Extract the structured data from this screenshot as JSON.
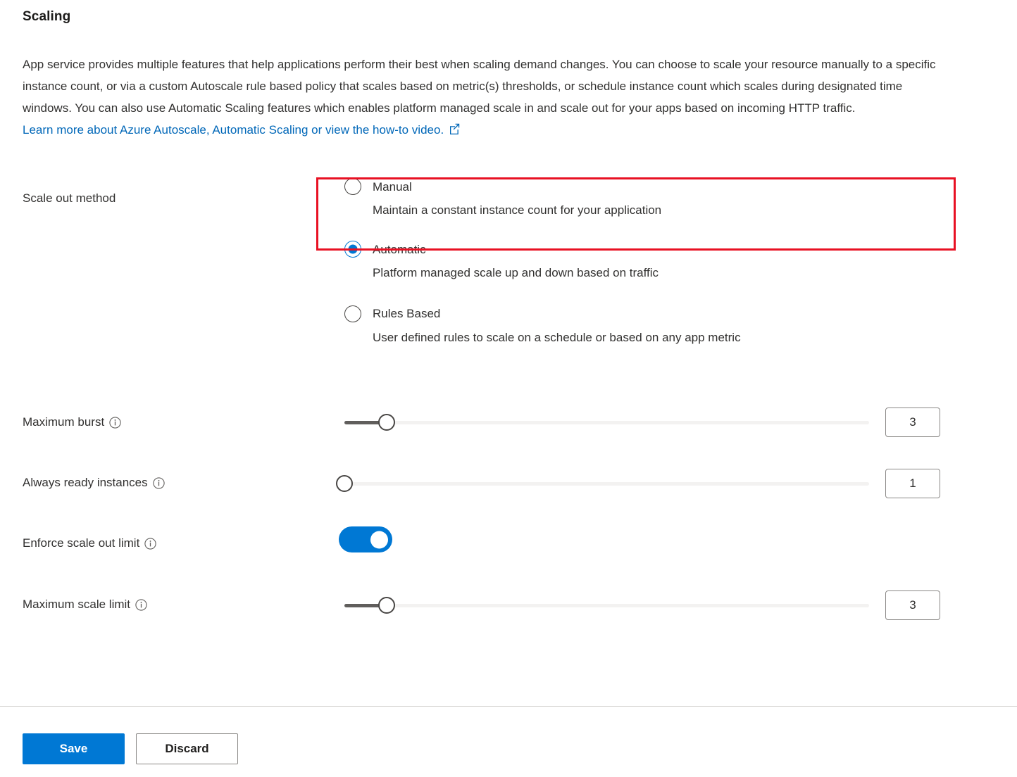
{
  "page": {
    "title": "Scaling",
    "description_lines": [
      "App service provides multiple features that help applications perform their best when scaling demand changes. You can choose",
      "to scale your resource manually to a specific instance count, or via a custom Autoscale rule based policy that scales based on",
      "metric(s) thresholds, or schedule instance count which scales during designated time windows. You can also use Automatic",
      "Scaling features which enables platform managed scale in and scale out for your apps based on incoming HTTP traffic."
    ],
    "learn_more_text": "Learn more about Azure Autoscale, Automatic Scaling or view the how-to video.",
    "external_link_icon": "external-link-icon"
  },
  "scale_out_method": {
    "label": "Scale out method",
    "selected": "Automatic",
    "options": [
      {
        "label": "Manual",
        "description": "Maintain a constant instance count for your application",
        "checked": false,
        "highlighted": true
      },
      {
        "label": "Automatic",
        "description": "Platform managed scale up and down based on traffic",
        "checked": true,
        "highlighted": false
      },
      {
        "label": "Rules Based",
        "description": "User defined rules to scale on a schedule or based on any app metric",
        "checked": false,
        "highlighted": false
      }
    ]
  },
  "settings": {
    "maximum_burst": {
      "label": "Maximum burst",
      "info_icon": "info-icon",
      "value": "3",
      "slider_percent": 8
    },
    "always_ready_instances": {
      "label": "Always ready instances",
      "info_icon": "info-icon",
      "value": "1",
      "slider_percent": 0
    },
    "enforce_scale_out_limit": {
      "label": "Enforce scale out limit",
      "info_icon": "info-icon",
      "toggle_on": true,
      "toggle_state": "On"
    },
    "maximum_scale_limit": {
      "label": "Maximum scale limit",
      "info_icon": "info-icon",
      "value": "3",
      "slider_percent": 8
    }
  },
  "footer": {
    "save_label": "Save",
    "discard_label": "Discard"
  },
  "colors": {
    "accent": "#0078d4",
    "link": "#0067b8",
    "highlight_border": "#e81123",
    "slider_fill": "#605e5c",
    "slider_track": "#f3f2f1",
    "text": "#323130"
  }
}
